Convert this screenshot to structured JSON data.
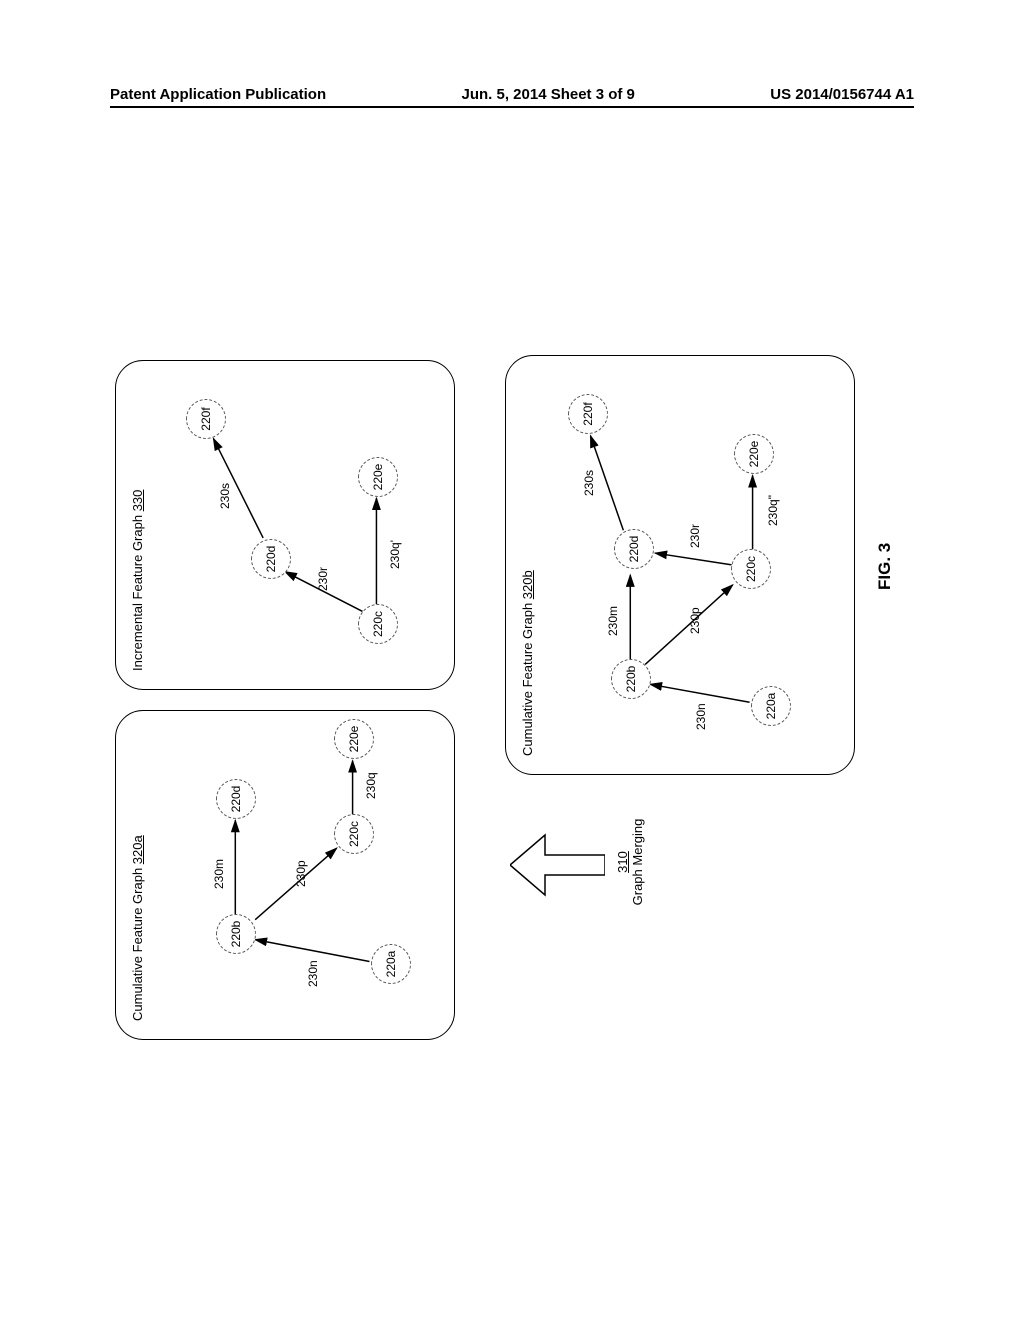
{
  "header": {
    "left": "Patent Application Publication",
    "center": "Jun. 5, 2014  Sheet 3 of 9",
    "right": "US 2014/0156744 A1"
  },
  "figure": {
    "caption": "FIG. 3",
    "merge": {
      "ref": "310",
      "label": "Graph Merging"
    },
    "panels": {
      "p320a": {
        "title_a": "Cumulative Feature Graph ",
        "title_ref": "320a"
      },
      "p330": {
        "title_a": "Incremental Feature Graph ",
        "title_ref": "330"
      },
      "p320b": {
        "title_a": "Cumulative Feature Graph ",
        "title_ref": "320b"
      }
    },
    "nodes": {
      "n220a": "220a",
      "n220b": "220b",
      "n220c": "220c",
      "n220d": "220d",
      "n220e": "220e",
      "n220f": "220f"
    },
    "edges": {
      "e230m": "230m",
      "e230n": "230n",
      "e230p": "230p",
      "e230q": "230q",
      "e230r": "230r",
      "e230s": "230s",
      "e230q1": "230q'",
      "e230q2": "230q\""
    }
  }
}
